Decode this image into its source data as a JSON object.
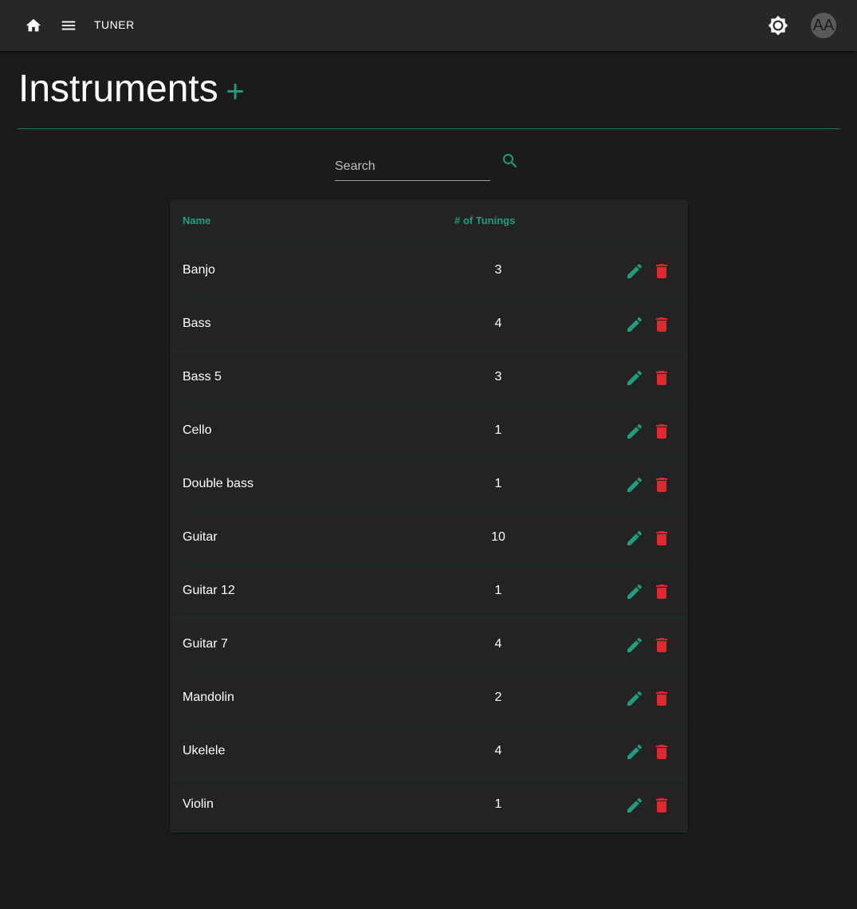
{
  "app": {
    "title": "TUNER",
    "avatar_initials": "AA"
  },
  "page": {
    "title": "Instruments",
    "add_symbol": "+"
  },
  "search": {
    "placeholder": "Search",
    "value": ""
  },
  "table": {
    "columns": {
      "name": "Name",
      "tunings": "# of Tunings"
    },
    "rows": [
      {
        "name": "Banjo",
        "count": "3"
      },
      {
        "name": "Bass",
        "count": "4"
      },
      {
        "name": "Bass 5",
        "count": "3"
      },
      {
        "name": "Cello",
        "count": "1"
      },
      {
        "name": "Double bass",
        "count": "1"
      },
      {
        "name": "Guitar",
        "count": "10"
      },
      {
        "name": "Guitar 12",
        "count": "1"
      },
      {
        "name": "Guitar 7",
        "count": "4"
      },
      {
        "name": "Mandolin",
        "count": "2"
      },
      {
        "name": "Ukelele",
        "count": "4"
      },
      {
        "name": "Violin",
        "count": "1"
      }
    ]
  },
  "icons": {
    "home": "home-icon",
    "menu": "menu-icon",
    "theme": "brightness-icon",
    "search": "search-icon",
    "edit": "pencil-icon",
    "delete": "trash-icon"
  },
  "colors": {
    "accent": "#1e9e7f",
    "danger": "#e0282e",
    "background": "#1b1b1b",
    "appbar": "#272727",
    "card": "#232323"
  }
}
